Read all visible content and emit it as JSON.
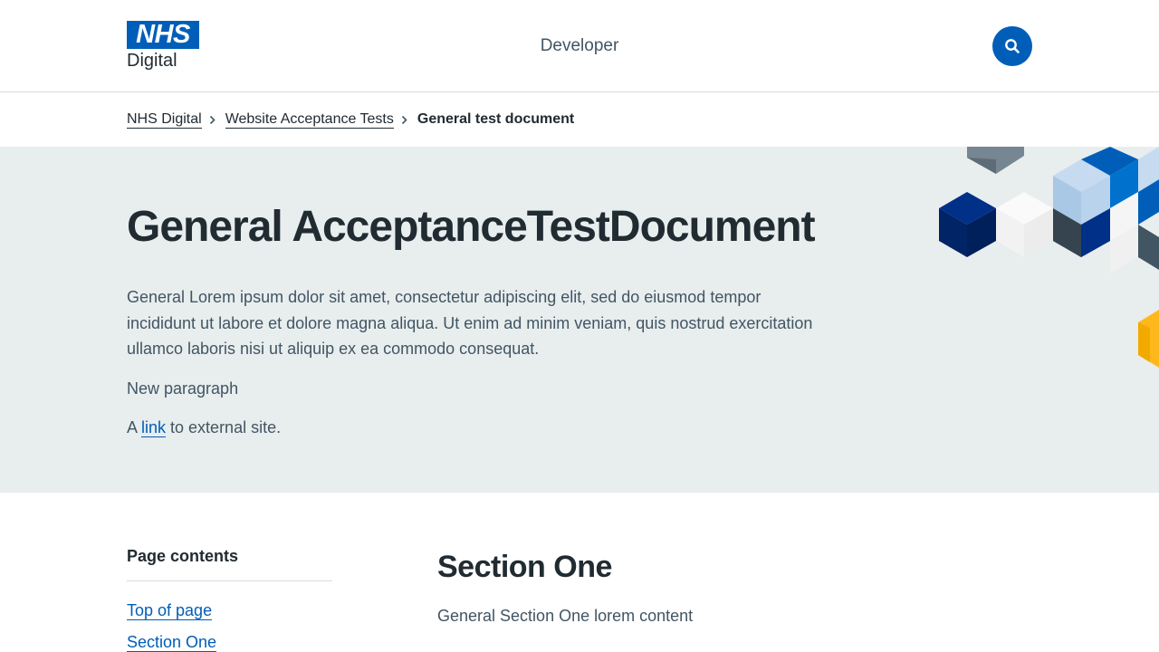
{
  "header": {
    "logo_mark": "NHS",
    "logo_text": "Digital",
    "site_title": "Developer"
  },
  "breadcrumb": {
    "items": [
      "NHS Digital",
      "Website Acceptance Tests"
    ],
    "current": "General test document"
  },
  "hero": {
    "title": "General AcceptanceTestDocument",
    "lead": "General Lorem ipsum dolor sit amet, consectetur adipiscing elit, sed do eiusmod tempor incididunt ut labore et dolore magna aliqua. Ut enim ad minim veniam, quis nostrud exercitation ullamco laboris nisi ut aliquip ex ea commodo consequat.",
    "paragraph2": "New paragraph",
    "p3_before": "A ",
    "p3_link": "link",
    "p3_after": " to external site."
  },
  "toc": {
    "title": "Page contents",
    "items": [
      "Top of page",
      "Section One"
    ]
  },
  "main": {
    "heading": "Section One",
    "text": "General Section One lorem content"
  },
  "colors": {
    "brand_blue": "#005eb8",
    "hero_bg": "#e8edee",
    "text": "#212b32",
    "secondary_text": "#425563"
  }
}
